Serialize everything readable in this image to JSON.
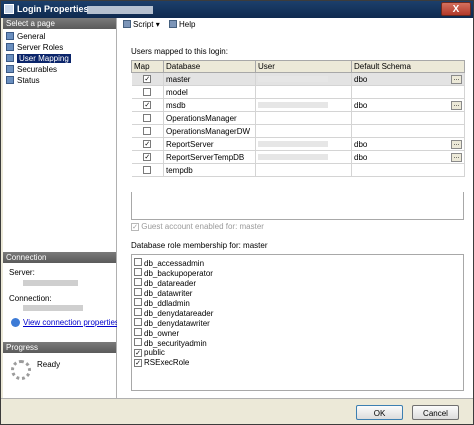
{
  "window": {
    "title": "Login Properties",
    "close_glyph": "X"
  },
  "left_pane": {
    "select_page_header": "Select a page",
    "pages": [
      {
        "label": "General",
        "selected": false
      },
      {
        "label": "Server Roles",
        "selected": false
      },
      {
        "label": "User Mapping",
        "selected": true
      },
      {
        "label": "Securables",
        "selected": false
      },
      {
        "label": "Status",
        "selected": false
      }
    ],
    "connection_header": "Connection",
    "server_label": "Server:",
    "connection_label": "Connection:",
    "view_connection_link": "View connection properties",
    "progress_header": "Progress",
    "progress_status": "Ready"
  },
  "toolbar": {
    "script_label": "Script",
    "script_arrow": "▾",
    "help_label": "Help"
  },
  "users_mapped": {
    "label": "Users mapped to this login:",
    "columns": [
      "Map",
      "Database",
      "User",
      "Default Schema"
    ],
    "rows": [
      {
        "map": true,
        "database": "master",
        "has_user": true,
        "schema": "dbo",
        "selected": true
      },
      {
        "map": false,
        "database": "model",
        "has_user": false,
        "schema": "",
        "selected": false
      },
      {
        "map": true,
        "database": "msdb",
        "has_user": true,
        "schema": "dbo",
        "selected": false
      },
      {
        "map": false,
        "database": "OperationsManager",
        "has_user": false,
        "schema": "",
        "selected": false
      },
      {
        "map": false,
        "database": "OperationsManagerDW",
        "has_user": false,
        "schema": "",
        "selected": false
      },
      {
        "map": true,
        "database": "ReportServer",
        "has_user": true,
        "schema": "dbo",
        "selected": false
      },
      {
        "map": true,
        "database": "ReportServerTempDB",
        "has_user": true,
        "schema": "dbo",
        "selected": false
      },
      {
        "map": false,
        "database": "tempdb",
        "has_user": false,
        "schema": "",
        "selected": false
      }
    ],
    "ellipsis": "..."
  },
  "guest": {
    "label": "Guest account enabled for: master",
    "checked": true
  },
  "roles": {
    "label": "Database role membership for: master",
    "items": [
      {
        "label": "db_accessadmin",
        "checked": false
      },
      {
        "label": "db_backupoperator",
        "checked": false
      },
      {
        "label": "db_datareader",
        "checked": false
      },
      {
        "label": "db_datawriter",
        "checked": false
      },
      {
        "label": "db_ddladmin",
        "checked": false
      },
      {
        "label": "db_denydatareader",
        "checked": false
      },
      {
        "label": "db_denydatawriter",
        "checked": false
      },
      {
        "label": "db_owner",
        "checked": false
      },
      {
        "label": "db_securityadmin",
        "checked": false
      },
      {
        "label": "public",
        "checked": true
      },
      {
        "label": "RSExecRole",
        "checked": true
      }
    ]
  },
  "footer": {
    "ok_label": "OK",
    "cancel_label": "Cancel"
  }
}
